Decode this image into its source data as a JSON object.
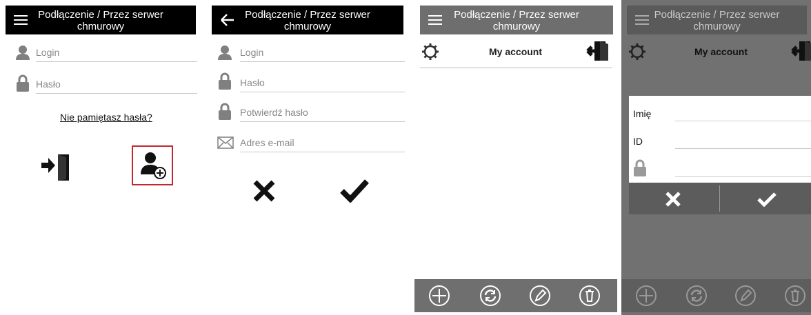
{
  "login_screen": {
    "title_line1": "Podłączenie / Przez serwer",
    "title_line2": "chmurowy",
    "login_placeholder": "Login",
    "password_placeholder": "Hasło",
    "forgot_password": "Nie pamiętasz hasła?"
  },
  "register_screen": {
    "title_line1": "Podłączenie / Przez serwer",
    "title_line2": "chmurowy",
    "login_placeholder": "Login",
    "password_placeholder": "Hasło",
    "confirm_password_placeholder": "Potwierdź hasło",
    "email_placeholder": "Adres e-mail"
  },
  "account_screen": {
    "title_line1": "Podłączenie / Przez serwer",
    "title_line2": "chmurowy",
    "section_title": "My account"
  },
  "account_dialog_screen": {
    "title_line1": "Podłączenie / Przez serwer",
    "title_line2": "chmurowy",
    "section_title": "My account",
    "dialog": {
      "name_label": "Imię",
      "id_label": "ID"
    }
  },
  "colors": {
    "highlight_border": "#c0282d",
    "header_bg": "#000000",
    "dim_overlay": "#717171"
  }
}
